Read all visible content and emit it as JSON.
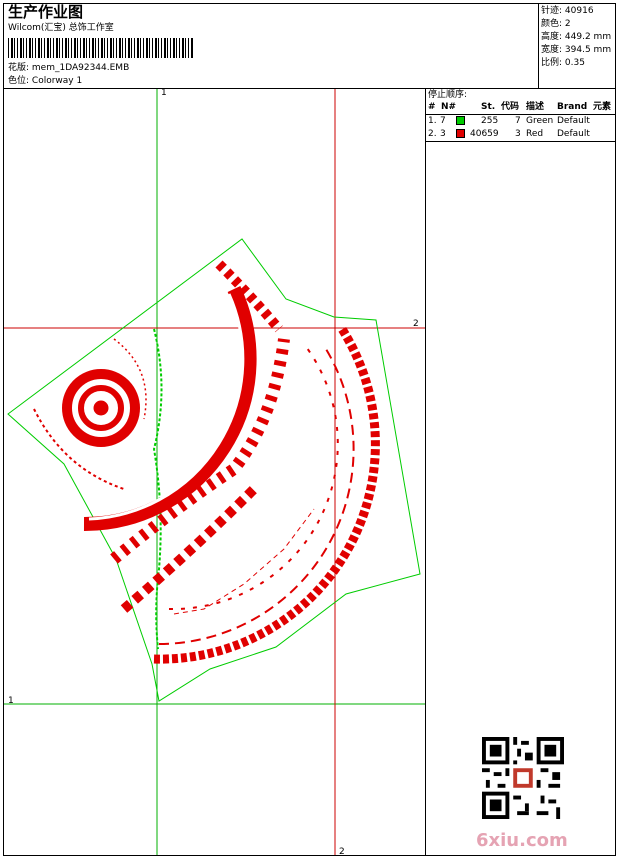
{
  "header": {
    "title": "生产作业图",
    "company": "Wilcom(汇宝) 总饰工作室",
    "design_label": "花版: ",
    "design_file": "mem_1DA92344.EMB",
    "colorway_label": "色位: ",
    "colorway": "Colorway 1"
  },
  "stats": {
    "stitches_label": "针迹:",
    "stitches": "40916",
    "colors_label": "颜色:",
    "colors": "2",
    "height_label": "高度:",
    "height": "449.2 mm",
    "width_label": "宽度:",
    "width": "394.5 mm",
    "scale_label": "比例:",
    "scale": "0.35"
  },
  "sequence": {
    "title": "停止顺序:",
    "columns": [
      "#",
      "N#",
      "St.",
      "代码",
      "描述",
      "Brand",
      "元素"
    ],
    "rows": [
      {
        "index": "1.",
        "needle": "7",
        "color": "#00cc00",
        "stitches": "255",
        "code": "7",
        "desc": "Green",
        "brand": "Default"
      },
      {
        "index": "2.",
        "needle": "3",
        "color": "#e00000",
        "stitches": "40659",
        "code": "3",
        "desc": "Red",
        "brand": "Default"
      }
    ]
  },
  "guides": {
    "v1_label": "1",
    "h1_label": "1",
    "h2_label": "2",
    "v2_label": "2"
  },
  "watermark": "6xiu.com",
  "colors": {
    "thread_green": "#00cc00",
    "thread_red": "#e00000",
    "guide_green": "#00b000",
    "guide_red": "#cc0000"
  }
}
